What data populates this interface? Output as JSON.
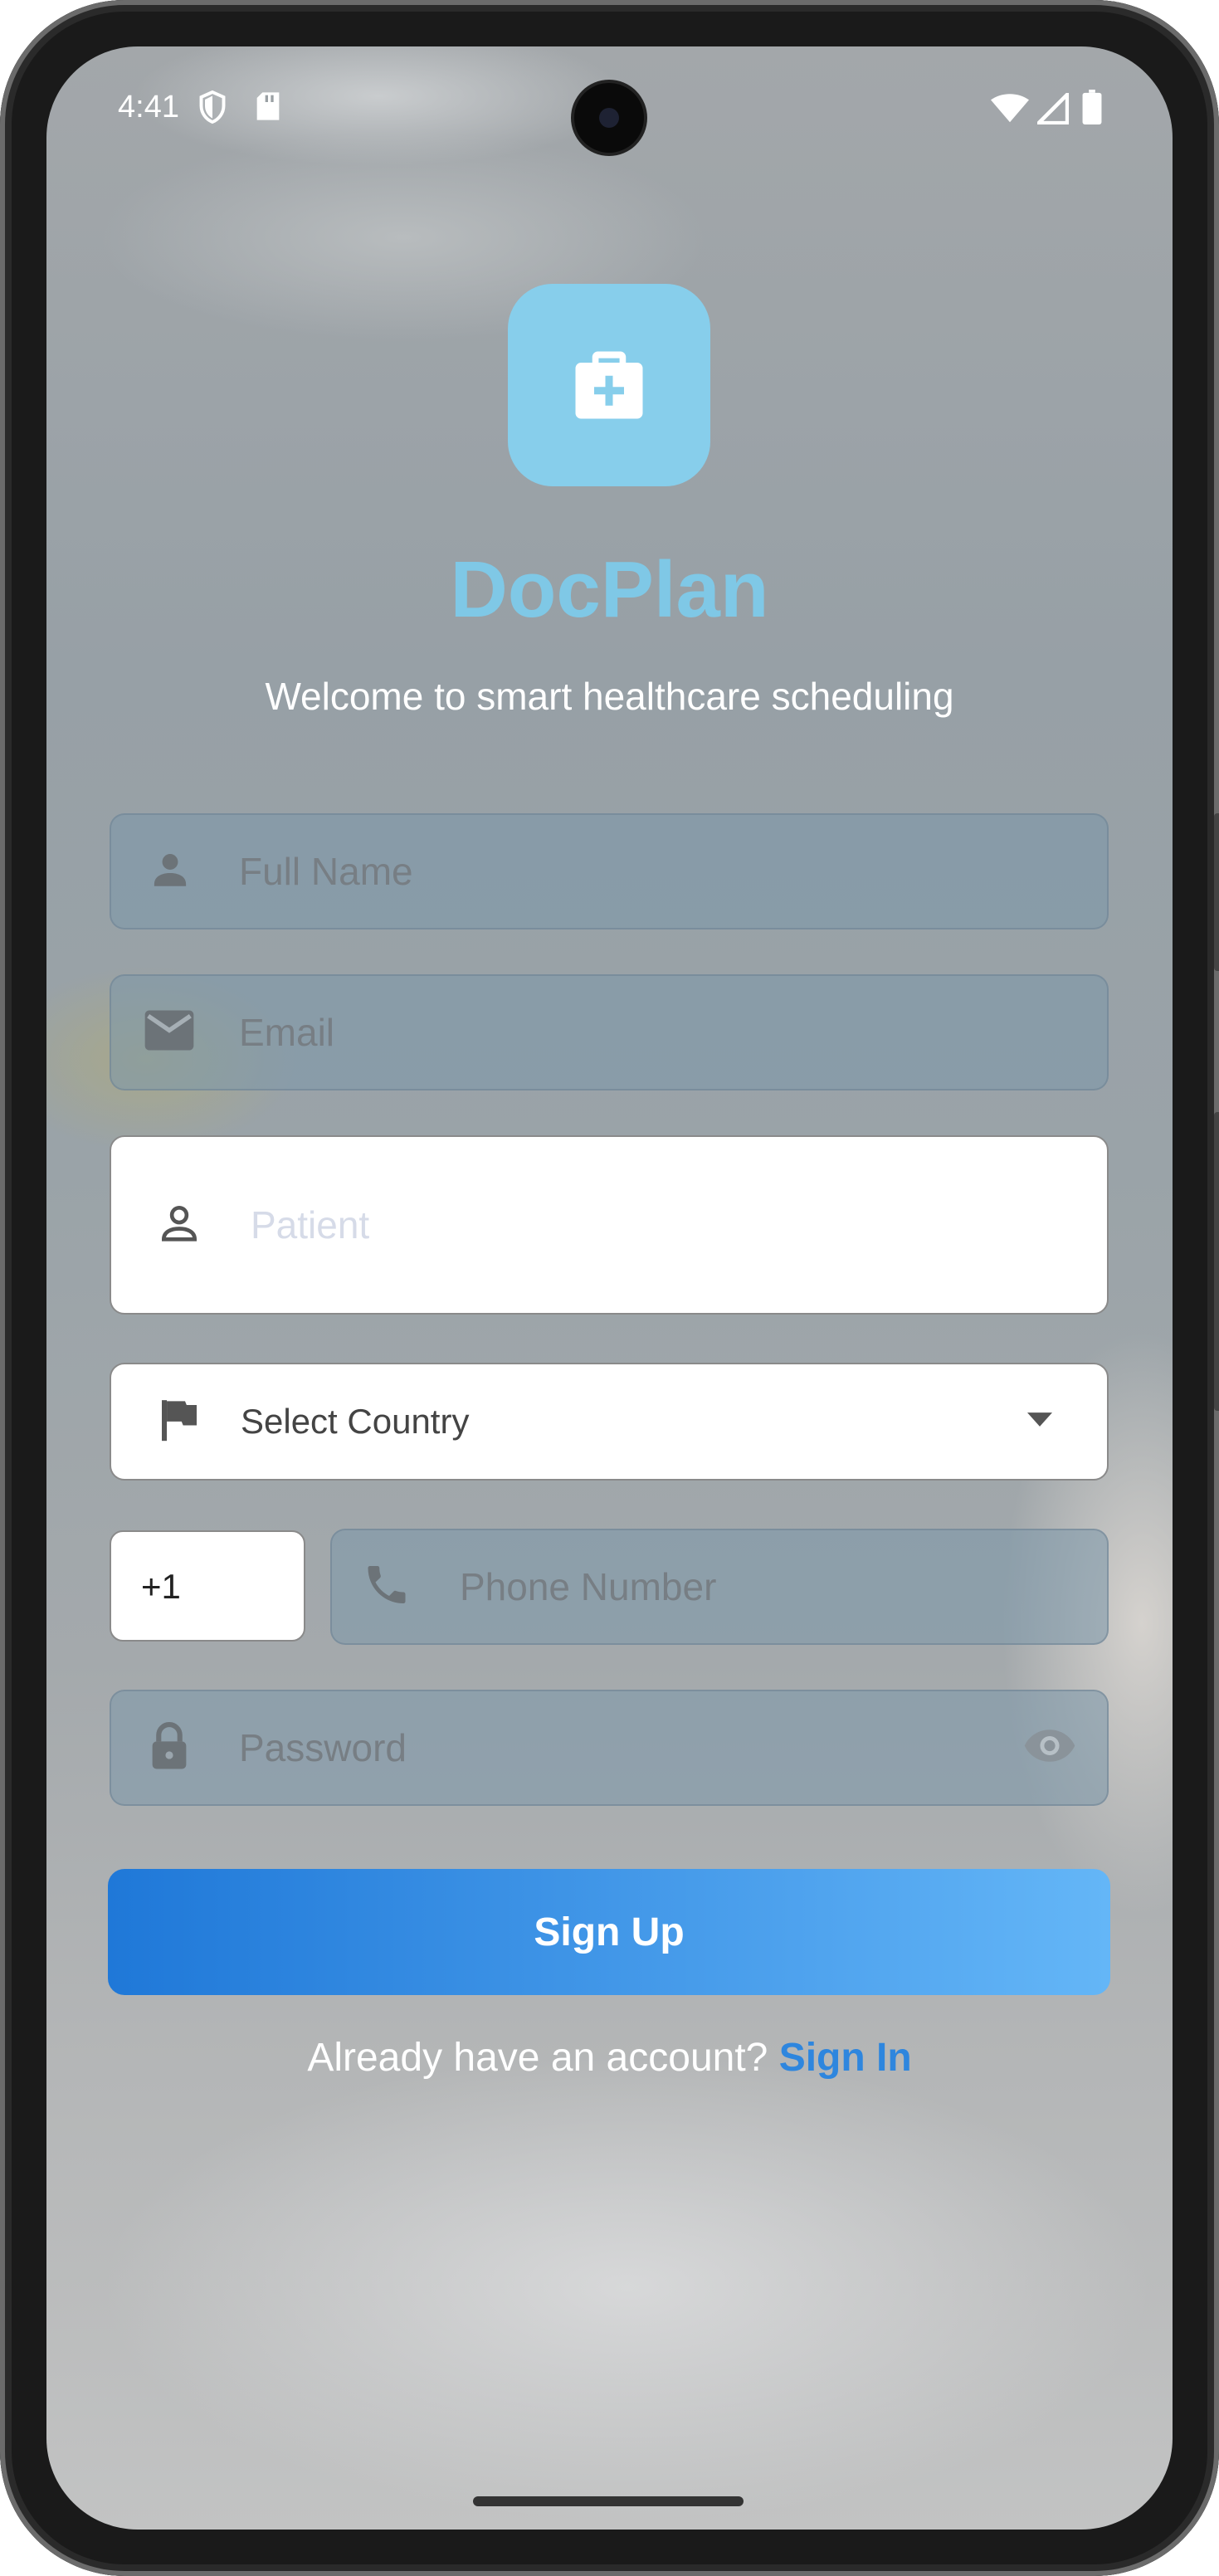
{
  "status_bar": {
    "time": "4:41",
    "icons": [
      "shield-icon",
      "sd-card-icon",
      "wifi-icon",
      "signal-icon",
      "battery-icon"
    ]
  },
  "app": {
    "logo_icon": "medical-bag-icon",
    "title": "DocPlan",
    "tagline": "Welcome to smart healthcare scheduling"
  },
  "form": {
    "full_name": {
      "placeholder": "Full Name",
      "icon": "person-icon"
    },
    "email": {
      "placeholder": "Email",
      "icon": "mail-icon"
    },
    "role": {
      "value": "Patient",
      "icon": "person-outline-icon"
    },
    "country": {
      "value": "Select Country",
      "icon": "flag-icon",
      "dropdown_icon": "dropdown-arrow-icon"
    },
    "country_code": {
      "value": "+1"
    },
    "phone": {
      "placeholder": "Phone Number",
      "icon": "phone-icon"
    },
    "password": {
      "placeholder": "Password",
      "icon": "lock-icon",
      "toggle_icon": "eye-icon"
    },
    "submit_label": "Sign Up"
  },
  "footer": {
    "prompt": "Already have an account?",
    "link": "Sign In"
  },
  "colors": {
    "brand": "#87CEEB",
    "button_start": "#1F78D8",
    "button_end": "#64B6F7",
    "link": "#2E86DE"
  }
}
